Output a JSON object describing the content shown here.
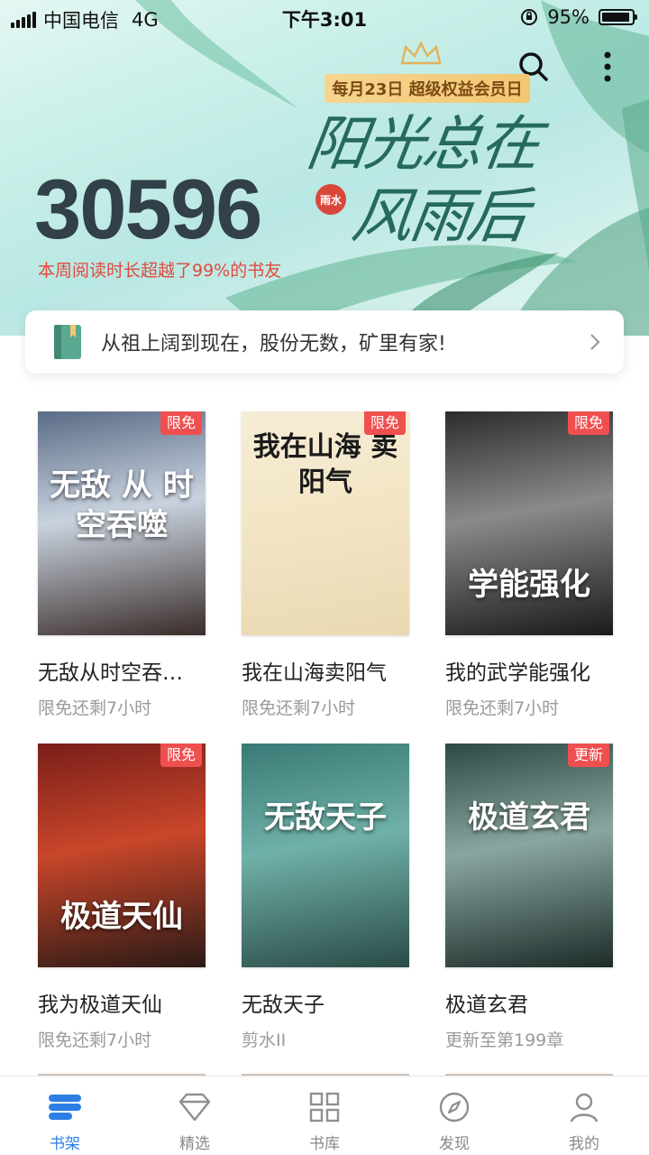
{
  "status_bar": {
    "carrier": "中国电信",
    "network": "4G",
    "time": "下午3:01",
    "battery_percent": "95%",
    "battery_level": 0.95
  },
  "header": {
    "promo_ribbon": "每月23日 超级权益会员日",
    "slogan_line1": "阳光总在",
    "slogan_line2": "风雨后",
    "seal_text": "雨水",
    "reading_number": "30596",
    "reading_subtitle": "本周阅读时长超越了99%的书友",
    "icons": [
      "search-icon",
      "more-icon"
    ]
  },
  "quote_card": {
    "text": "从祖上阔到现在，股份无数，矿里有家!"
  },
  "books": [
    {
      "title": "无敌从时空吞…",
      "subtitle": "限免还剩7小时",
      "badge": "限免",
      "cover_text": "无敌 从 时空吞噬",
      "cover_colors": [
        "#5a6b86",
        "#c9d3df",
        "#3a2c2a"
      ]
    },
    {
      "title": "我在山海卖阳气",
      "subtitle": "限免还剩7小时",
      "badge": "限免",
      "cover_text": "我在山海 卖阳气",
      "cover_colors": [
        "#f6edd6",
        "#f3e6c6",
        "#e8d9b2"
      ]
    },
    {
      "title": "我的武学能强化",
      "subtitle": "限免还剩7小时",
      "badge": "限免",
      "cover_text": "学能强化",
      "cover_colors": [
        "#2c2c2c",
        "#8a8a8a",
        "#1a1a1a"
      ]
    },
    {
      "title": "我为极道天仙",
      "subtitle": "限免还剩7小时",
      "badge": "限免",
      "cover_text": "极道天仙",
      "cover_colors": [
        "#7a1e1a",
        "#c8462a",
        "#2b1a16"
      ]
    },
    {
      "title": "无敌天子",
      "subtitle": "剪水II",
      "badge": "",
      "cover_text": "无敌天子",
      "cover_colors": [
        "#3a7a76",
        "#6fb1a8",
        "#2b4b47"
      ]
    },
    {
      "title": "极道玄君",
      "subtitle": "更新至第199章",
      "badge": "更新",
      "cover_text": "极道玄君",
      "cover_colors": [
        "#2f4a44",
        "#8aa6a0",
        "#1c2c29"
      ]
    }
  ],
  "bottom_nav": [
    {
      "label": "书架",
      "icon": "bookshelf-icon",
      "active": true
    },
    {
      "label": "精选",
      "icon": "diamond-icon",
      "active": false
    },
    {
      "label": "书库",
      "icon": "grid-icon",
      "active": false
    },
    {
      "label": "发现",
      "icon": "compass-icon",
      "active": false
    },
    {
      "label": "我的",
      "icon": "profile-icon",
      "active": false
    }
  ],
  "colors": {
    "accent": "#2b7fe5",
    "badge": "#ef4f4f",
    "reading_sub": "#e04a3c",
    "promo": "#f2c772"
  }
}
